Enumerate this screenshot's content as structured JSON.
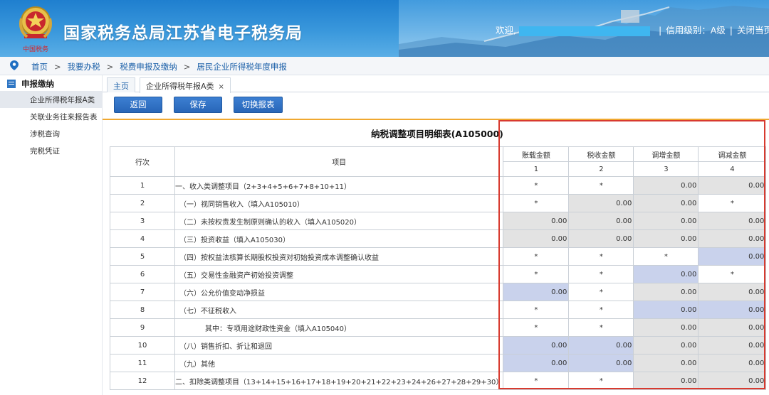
{
  "header": {
    "site_title": "国家税务总局江苏省电子税务局",
    "welcome": "欢迎,",
    "credit_label": "信用级别：A级",
    "close_label": "关闭当页"
  },
  "breadcrumb": [
    "首页",
    "我要办税",
    "税费申报及缴纳",
    "居民企业所得税年度申报"
  ],
  "sidebar": {
    "group": "申报缴纳",
    "items": [
      {
        "label": "企业所得税年报A类"
      },
      {
        "label": "关联业务往来报告表"
      },
      {
        "label": "涉税查询"
      },
      {
        "label": "完税凭证"
      }
    ]
  },
  "tabs": [
    {
      "label": "主页"
    },
    {
      "label": "企业所得税年报A类"
    }
  ],
  "toolbar": {
    "back": "返回",
    "save": "保存",
    "switch": "切换报表"
  },
  "form": {
    "title": "纳税调整项目明细表(A105000)",
    "headers": {
      "line_no": "行次",
      "item": "项目",
      "cols": [
        "账载金额",
        "税收金额",
        "调增金额",
        "调减金额"
      ],
      "col_nums": [
        "1",
        "2",
        "3",
        "4"
      ]
    },
    "rows": [
      {
        "ln": "1",
        "item": "一、收入类调整项目（2+3+4+5+6+7+8+10+11）",
        "cells": [
          "*",
          "*",
          "0.00",
          "0.00"
        ]
      },
      {
        "ln": "2",
        "item": "（一）视同销售收入（填入A105010）",
        "cells": [
          "*",
          "0.00",
          "0.00",
          "*"
        ]
      },
      {
        "ln": "3",
        "item": "（二）未按权责发生制原则确认的收入（填入A105020）",
        "cells": [
          "0.00",
          "0.00",
          "0.00",
          "0.00"
        ]
      },
      {
        "ln": "4",
        "item": "（三）投资收益（填入A105030）",
        "cells": [
          "0.00",
          "0.00",
          "0.00",
          "0.00"
        ]
      },
      {
        "ln": "5",
        "item": "（四）按权益法核算长期股权投资对初始投资成本调整确认收益",
        "cells": [
          "*",
          "*",
          "*",
          "0.00"
        ]
      },
      {
        "ln": "6",
        "item": "（五）交易性金融资产初始投资调整",
        "cells": [
          "*",
          "*",
          "0.00",
          "*"
        ]
      },
      {
        "ln": "7",
        "item": "（六）公允价值变动净损益",
        "cells": [
          "0.00",
          "*",
          "0.00",
          "0.00"
        ]
      },
      {
        "ln": "8",
        "item": "（七）不征税收入",
        "cells": [
          "*",
          "*",
          "0.00",
          "0.00"
        ]
      },
      {
        "ln": "9",
        "item": "其中：专项用途财政性资金（填入A105040）",
        "cells": [
          "*",
          "*",
          "0.00",
          "0.00"
        ]
      },
      {
        "ln": "10",
        "item": "（八）销售折扣、折让和退回",
        "cells": [
          "0.00",
          "0.00",
          "0.00",
          "0.00"
        ]
      },
      {
        "ln": "11",
        "item": "（九）其他",
        "cells": [
          "0.00",
          "0.00",
          "0.00",
          "0.00"
        ]
      },
      {
        "ln": "12",
        "item": "二、扣除类调整项目（13+14+15+16+17+18+19+20+21+22+23+24+26+27+28+29+30）",
        "cells": [
          "*",
          "*",
          "0.00",
          "0.00"
        ]
      }
    ],
    "cell_fill": [
      [
        "w",
        "w",
        "g",
        "g"
      ],
      [
        "w",
        "g",
        "g",
        "w"
      ],
      [
        "g",
        "g",
        "g",
        "g"
      ],
      [
        "g",
        "g",
        "g",
        "g"
      ],
      [
        "w",
        "w",
        "w",
        "b"
      ],
      [
        "w",
        "w",
        "b",
        "w"
      ],
      [
        "b",
        "w",
        "g",
        "g"
      ],
      [
        "w",
        "w",
        "b",
        "b"
      ],
      [
        "w",
        "w",
        "g",
        "g"
      ],
      [
        "b",
        "b",
        "g",
        "g"
      ],
      [
        "b",
        "b",
        "g",
        "g"
      ],
      [
        "w",
        "w",
        "g",
        "g"
      ]
    ],
    "indent": [
      "none",
      "sub",
      "sub",
      "sub",
      "sub",
      "sub",
      "sub",
      "sub",
      "subsub",
      "sub",
      "sub",
      "none"
    ]
  },
  "colors": {
    "header_blue": "#2f86d2",
    "button_blue": "#2c6cbf",
    "highlight_red": "#d83a2f",
    "readonly_gray": "#e3e3e3",
    "editable_blue": "#c9d2ec",
    "toolbar_rule_orange": "#f0a830"
  }
}
